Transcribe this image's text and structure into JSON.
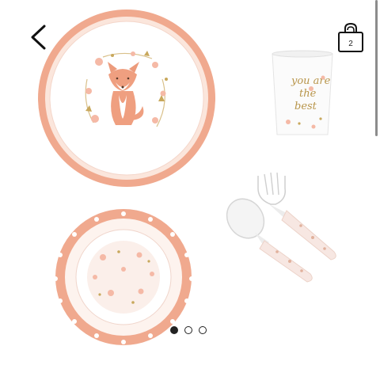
{
  "header": {
    "back_icon": "chevron-left-icon",
    "bag_icon": "shopping-bag-icon",
    "bag_count": "2"
  },
  "product_image": {
    "cup_text": [
      "you are",
      "the",
      "best"
    ],
    "items": [
      "plate",
      "cup",
      "fork",
      "spoon",
      "bowl"
    ]
  },
  "pager": {
    "total": 3,
    "active_index": 0
  },
  "colors": {
    "rim": "#f0a98e",
    "rim_dark": "#e68c72",
    "gold": "#b8954a",
    "indicator": "#222222"
  }
}
